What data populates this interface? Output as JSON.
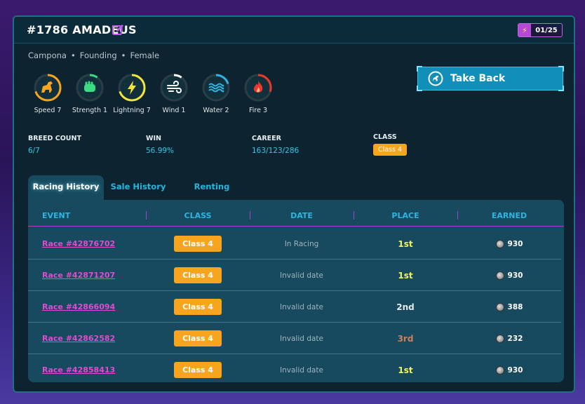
{
  "header": {
    "title": "#1786 AMADEUS",
    "energy": "01/25",
    "energy_icon": "lightning-icon"
  },
  "meta": {
    "breed": "Campona",
    "origin": "Founding",
    "gender": "Female"
  },
  "stats": [
    {
      "label": "Speed 7",
      "color": "#f7a51e",
      "icon": "horse-icon",
      "progress": 0.7
    },
    {
      "label": "Strength 1",
      "color": "#3ddc84",
      "icon": "fist-icon",
      "progress": 0.1
    },
    {
      "label": "Lightning 7",
      "color": "#f2e43a",
      "icon": "lightning-icon",
      "progress": 0.7
    },
    {
      "label": "Wind 1",
      "color": "#ffffff",
      "icon": "wind-icon",
      "progress": 0.1
    },
    {
      "label": "Water 2",
      "color": "#2fb4e2",
      "icon": "water-icon",
      "progress": 0.2
    },
    {
      "label": "Fire 3",
      "color": "#e8392c",
      "icon": "fire-icon",
      "progress": 0.3
    }
  ],
  "take_back": {
    "label": "Take Back"
  },
  "info": {
    "breed_count_label": "BREED COUNT",
    "breed_count_value": "6/7",
    "win_label": "WIN",
    "win_value": "56.99%",
    "career_label": "CAREER",
    "career_value": "163/123/286",
    "class_label": "CLASS",
    "class_value": "Class 4"
  },
  "tabs": [
    {
      "label": "Racing History",
      "active": true
    },
    {
      "label": "Sale History",
      "active": false
    },
    {
      "label": "Renting History",
      "active": false
    }
  ],
  "table": {
    "columns": [
      "EVENT",
      "CLASS",
      "DATE",
      "PLACE",
      "EARNED"
    ],
    "rows": [
      {
        "event": "Race #42876702",
        "class": "Class 4",
        "date": "In Racing",
        "place": "1st",
        "earned": "930"
      },
      {
        "event": "Race #42871207",
        "class": "Class 4",
        "date": "Invalid date",
        "place": "1st",
        "earned": "930"
      },
      {
        "event": "Race #42866094",
        "class": "Class 4",
        "date": "Invalid date",
        "place": "2nd",
        "earned": "388"
      },
      {
        "event": "Race #42862582",
        "class": "Class 4",
        "date": "Invalid date",
        "place": "3rd",
        "earned": "232"
      },
      {
        "event": "Race #42858413",
        "class": "Class 4",
        "date": "Invalid date",
        "place": "1st",
        "earned": "930"
      }
    ]
  },
  "colors": {
    "first": "#f2f55a",
    "second": "#e4eaee",
    "third": "#c9825a"
  }
}
